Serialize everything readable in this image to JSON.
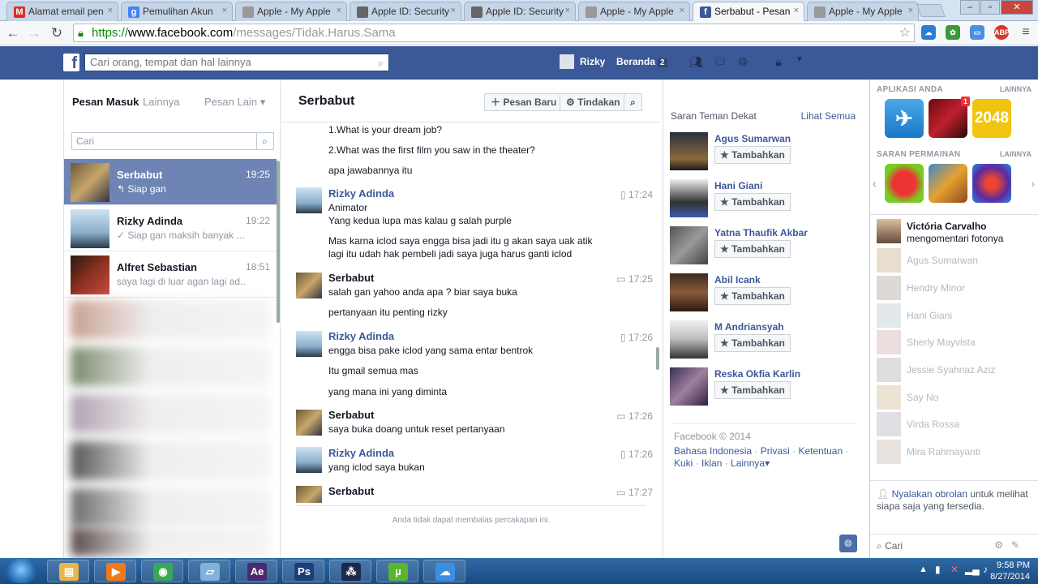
{
  "browser": {
    "tabs": [
      {
        "label": "Alamat email pen",
        "icon": "gmail-icon",
        "color": "#d93025",
        "glyph": "M"
      },
      {
        "label": "Pemulihan Akun",
        "icon": "google-icon",
        "color": "#4285f4",
        "glyph": "g"
      },
      {
        "label": "Apple - My Apple",
        "icon": "page-icon",
        "color": "#999999",
        "glyph": ""
      },
      {
        "label": "Apple ID: Security",
        "icon": "apple-icon",
        "color": "#666666",
        "glyph": ""
      },
      {
        "label": "Apple ID: Security",
        "icon": "apple-icon",
        "color": "#666666",
        "glyph": ""
      },
      {
        "label": "Apple - My Apple",
        "icon": "page-icon",
        "color": "#999999",
        "glyph": ""
      },
      {
        "label": "Serbabut - Pesan",
        "icon": "facebook-icon",
        "color": "#3b5998",
        "glyph": "f",
        "active": true
      },
      {
        "label": "Apple - My Apple",
        "icon": "page-icon",
        "color": "#999999",
        "glyph": ""
      }
    ],
    "url_scheme": "https://",
    "url_host": "www.facebook.com",
    "url_path": "/messages/Tidak.Harus.Sama",
    "ext_abp": "ABP"
  },
  "fb": {
    "search_placeholder": "Cari orang, tempat dan hal lainnya",
    "user_name": "Rizky",
    "home_label": "Beranda",
    "home_badge": "2"
  },
  "inbox": {
    "tab_inbox": "Pesan Masuk",
    "tab_other": "Lainnya",
    "tab_more": "Pesan Lain",
    "search_placeholder": "Cari",
    "conversations": [
      {
        "name": "Serbabut",
        "time": "19:25",
        "snippet": "↰ Siap gan"
      },
      {
        "name": "Rizky Adinda",
        "time": "19:22",
        "snippet": "✓ Siap gan maksih banyak ..."
      },
      {
        "name": "Alfret Sebastian",
        "time": "18:51",
        "snippet": "saya lagi di luar agan lagi ad..."
      }
    ]
  },
  "thread": {
    "title": "Serbabut",
    "new_message": "Pesan Baru",
    "actions": "Tindakan",
    "messages": [
      {
        "text": "1.What is your dream job?"
      },
      {
        "text": "2.What was the first film you saw in the theater?"
      },
      {
        "text": "apa jawabannya itu"
      },
      {
        "sender": "Rizky Adinda",
        "time": "17:24",
        "lines": [
          "Animator",
          "Yang kedua lupa mas kalau g salah purple",
          "Mas karna iclod saya engga bisa jadi itu g akan saya uak atik",
          "lagi itu udah hak pembeli jadi saya juga harus ganti iclod"
        ]
      },
      {
        "sender": "Serbabut",
        "time": "17:25",
        "lines": [
          "salah gan yahoo anda apa ? biar saya buka",
          "pertanyaan itu penting rizky"
        ]
      },
      {
        "sender": "Rizky Adinda",
        "time": "17:26",
        "lines": [
          "engga bisa pake iclod yang sama entar bentrok",
          "Itu gmail semua mas",
          "yang mana ini yang diminta"
        ]
      },
      {
        "sender": "Serbabut",
        "time": "17:26",
        "lines": [
          "saya buka doang untuk reset pertanyaan"
        ]
      },
      {
        "sender": "Rizky Adinda",
        "time": "17:26",
        "lines": [
          "yang iclod saya bukan"
        ]
      },
      {
        "sender": "Serbabut",
        "time": "17:27",
        "lines": []
      }
    ],
    "reply_note": "Anda tidak dapat membalas percakapan ini."
  },
  "suggestions": {
    "heading": "Saran Teman Dekat",
    "see_all": "Lihat Semua",
    "add_label": "Tambahkan",
    "people": [
      "Agus Sumarwan",
      "Hani Giani",
      "Yatna Thaufik Akbar",
      "Abil Icank",
      "M Andriansyah",
      "Reska Okfia Karlin"
    ],
    "footer_copy": "Facebook © 2014",
    "footer_links": [
      "Bahasa Indonesia",
      "Privasi",
      "Ketentuan",
      "Kuki",
      "Iklan",
      "Lainnya"
    ]
  },
  "sidebar": {
    "apps_head": "APLIKASI ANDA",
    "apps_more": "LAINNYA",
    "app_2048": "2048",
    "app_badge": "1",
    "games_head": "SARAN PERMAINAN",
    "games_more": "LAINNYA",
    "ticker_name": "Victória Carvalho",
    "ticker_text": "mengomentari fotonya",
    "chat_list": [
      "Agus Sumarwan",
      "Hendry Minor",
      "Hani Giani",
      "Sherly Mayvista",
      "Jessie Syahnaz Aziz",
      "Say No",
      "Virda Rossa",
      "Mira Rahmayanti"
    ],
    "chat_prompt_link": "Nyalakan obrolan",
    "chat_prompt_text": "untuk melihat siapa saja yang tersedia.",
    "chat_search": "Cari"
  },
  "taskbar": {
    "time": "9:58 PM",
    "date": "8/27/2014",
    "apps": [
      {
        "name": "explorer-icon",
        "glyph": "▤",
        "color": "#e8b64a"
      },
      {
        "name": "media-player-icon",
        "glyph": "▶",
        "color": "#f07a1a"
      },
      {
        "name": "chrome-icon",
        "glyph": "◉",
        "color": "#3aa757"
      },
      {
        "name": "window-icon",
        "glyph": "▱",
        "color": "#7fb3d9"
      },
      {
        "name": "after-effects-icon",
        "glyph": "Ae",
        "color": "#4b2a6f"
      },
      {
        "name": "photoshop-icon",
        "glyph": "Ps",
        "color": "#1c3f7a"
      },
      {
        "name": "blackberry-icon",
        "glyph": "⁂",
        "color": "#1a2a4a"
      },
      {
        "name": "utorrent-icon",
        "glyph": "µ",
        "color": "#5cb531"
      },
      {
        "name": "cloud-icon",
        "glyph": "☁",
        "color": "#3b8ee0"
      }
    ]
  }
}
